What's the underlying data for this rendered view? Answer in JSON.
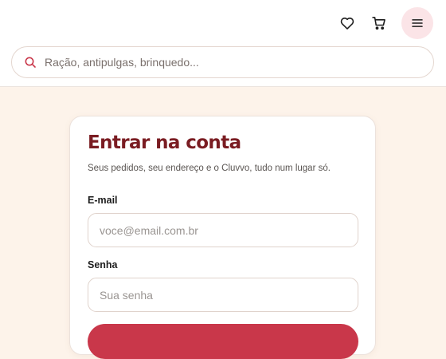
{
  "header": {
    "icons": [
      "heart-icon",
      "cart-icon",
      "menu-icon"
    ],
    "menu_active_bg": "#fbe4e7"
  },
  "search": {
    "placeholder": "Ração, antipulgas, brinquedo..."
  },
  "login": {
    "title": "Entrar na conta",
    "subtitle": "Seus pedidos, seu endereço e o Cluvvo, tudo num lugar só.",
    "email_label": "E-mail",
    "email_placeholder": "voce@email.com.br",
    "password_label": "Senha",
    "password_placeholder": "Sua senha"
  },
  "colors": {
    "accent": "#c9374a",
    "title": "#7a1c22",
    "page_bg": "#fdf3ea"
  }
}
